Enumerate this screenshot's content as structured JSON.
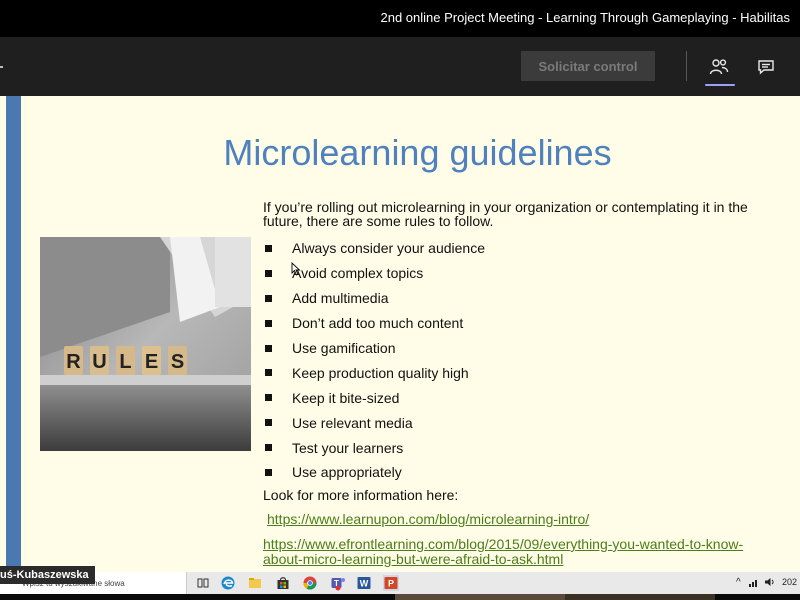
{
  "window": {
    "title": "2nd online Project Meeting - Learning Through Gameplaying - Habilitas"
  },
  "toolbar": {
    "request_control_label": "Solicitar control",
    "people_icon": "people-icon",
    "chat_icon": "chat-icon"
  },
  "slide": {
    "title": "Microlearning guidelines",
    "intro": "If you’re rolling out microlearning in your organization or contemplating it in the future, there are some rules to follow.",
    "image_caption_letters": [
      "R",
      "U",
      "L",
      "E",
      "S"
    ],
    "bullets": [
      "Always consider your audience",
      "Avoid complex topics",
      "Add multimedia",
      "Don’t add too much content",
      "Use gamification",
      "Keep production quality high",
      "Keep it bite-sized",
      "Use relevant media",
      "Test your learners",
      "Use appropriately"
    ],
    "more_info": "Look for more information here:",
    "links": [
      "https://www.learnupon.com/blog/microlearning-intro/",
      "https://www.efrontlearning.com/blog/2015/09/everything-you-wanted-to-know-about-micro-learning-but-were-afraid-to-ask.html"
    ]
  },
  "participant": {
    "name": "uś-Kubaszewska"
  },
  "taskbar": {
    "search_placeholder": "Wpisz tu wyszukiwane słowa",
    "apps": [
      "task-view-icon",
      "edge-icon",
      "file-explorer-icon",
      "store-icon",
      "chrome-icon",
      "teams-icon",
      "word-icon",
      "powerpoint-icon"
    ],
    "clock": "202"
  },
  "colors": {
    "slide_bg": "#fffde7",
    "title_blue": "#4e81bd",
    "link_green": "#4b7d19",
    "left_bar": "#4a78b0"
  }
}
